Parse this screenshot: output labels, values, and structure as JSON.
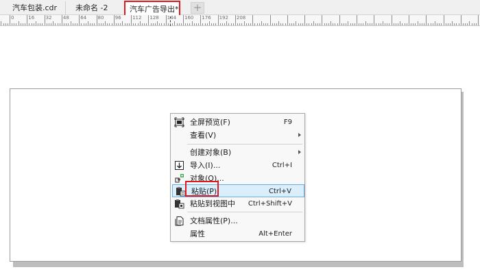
{
  "tabs": {
    "items": [
      {
        "label": "汽车包装.cdr"
      },
      {
        "label": "未命名 -2"
      },
      {
        "label": "汽车广告导出*"
      }
    ],
    "add_label": "+"
  },
  "ruler": {
    "labels": [
      "0",
      "16",
      "32",
      "48",
      "64",
      "80",
      "96",
      "112",
      "128",
      "144",
      "160",
      "176",
      "192",
      "208"
    ]
  },
  "context_menu": {
    "items": [
      {
        "label": "全屏预览(F)",
        "shortcut": "F9",
        "icon": "fullscreen-preview-icon"
      },
      {
        "label": "查看(V)",
        "submenu": true
      },
      {
        "label": "创建对象(B)",
        "submenu": true
      },
      {
        "label": "导入(I)...",
        "shortcut": "Ctrl+I",
        "icon": "import-icon"
      },
      {
        "label": "对象(O)...",
        "icon": "object-icon"
      },
      {
        "label": "粘贴(P)",
        "shortcut": "Ctrl+V",
        "icon": "paste-icon",
        "highlighted": true
      },
      {
        "label": "粘贴到视图中",
        "shortcut": "Ctrl+Shift+V",
        "icon": "paste-in-view-icon"
      },
      {
        "label": "文档属性(P)...",
        "icon": "document-properties-icon"
      },
      {
        "label": "属性",
        "shortcut": "Alt+Enter"
      }
    ]
  },
  "colors": {
    "annotation_red": "#e0191f",
    "menu_highlight": "#dbeefb",
    "menu_highlight_border": "#66aee6"
  }
}
